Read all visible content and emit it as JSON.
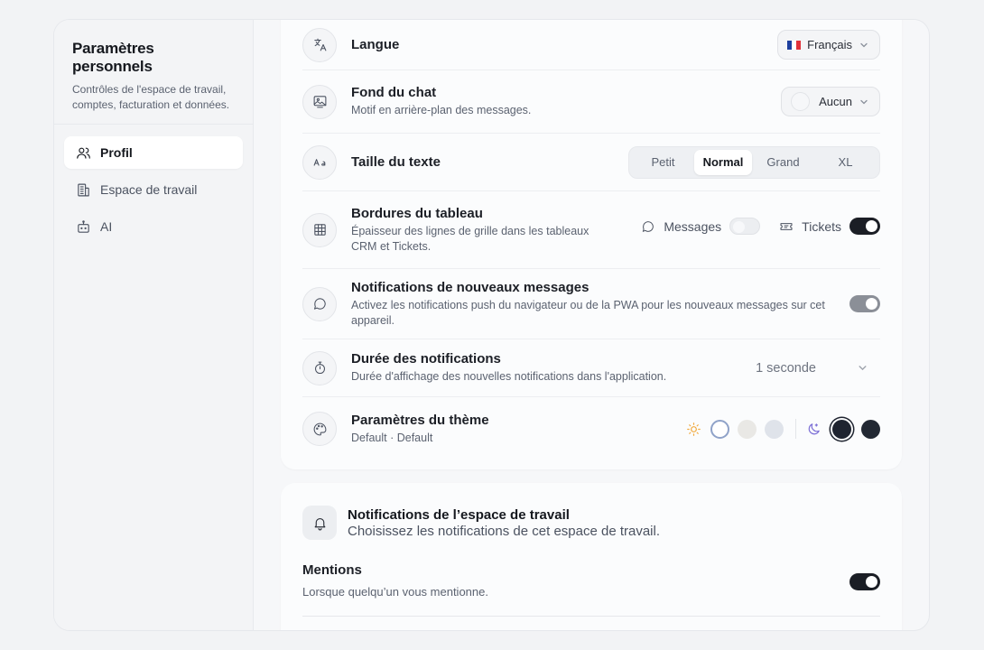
{
  "sidebar": {
    "title": "Paramètres personnels",
    "subtitle": "Contrôles de l'espace de travail, comptes, facturation et données.",
    "items": [
      {
        "label": "Profil",
        "icon": "users-icon",
        "active": true
      },
      {
        "label": "Espace de travail",
        "icon": "building-icon",
        "active": false
      },
      {
        "label": "AI",
        "icon": "bot-icon",
        "active": false
      }
    ]
  },
  "settings": {
    "language": {
      "title": "Langue",
      "value": "Français",
      "icon": "translate-icon"
    },
    "chat_bg": {
      "title": "Fond du chat",
      "desc": "Motif en arrière-plan des messages.",
      "value": "Aucun",
      "icon": "image-icon"
    },
    "text_size": {
      "title": "Taille du texte",
      "options": [
        "Petit",
        "Normal",
        "Grand",
        "XL"
      ],
      "selected": "Normal",
      "icon": "text-size-icon"
    },
    "table_borders": {
      "title": "Bordures du tableau",
      "desc": "Épaisseur des lignes de grille dans les tableaux CRM et Tickets.",
      "messages_label": "Messages",
      "messages_on": false,
      "tickets_label": "Tickets",
      "tickets_on": true,
      "icon": "grid-icon"
    },
    "new_msg_notif": {
      "title": "Notifications de nouveaux messages",
      "desc": "Activez les notifications push du navigateur ou de la PWA pour les nouveaux messages sur cet appareil.",
      "enabled": true,
      "icon": "chat-bubble-icon"
    },
    "notif_duration": {
      "title": "Durée des notifications",
      "desc": "Durée d'affichage des nouvelles notifications dans l'application.",
      "value": "1 seconde",
      "icon": "timer-icon"
    },
    "theme": {
      "title": "Paramètres du thème",
      "desc": "Default · Default",
      "light_colors": [
        "#ffffff",
        "#e9e8e5",
        "#dfe3ea"
      ],
      "dark_colors": [
        "#1f2430",
        "#222833"
      ],
      "icon": "palette-icon"
    }
  },
  "workspace_notifications": {
    "title": "Notifications de l’espace de travail",
    "subtitle": "Choisissez les notifications de cet espace de travail.",
    "mentions": {
      "title": "Mentions",
      "desc": "Lorsque quelqu’un vous mentionne.",
      "enabled": true
    }
  },
  "colors": {
    "accent_dark": "#1b1e25",
    "flag_blue": "#1d3f9e",
    "flag_white": "#ffffff",
    "flag_red": "#e0313b"
  }
}
